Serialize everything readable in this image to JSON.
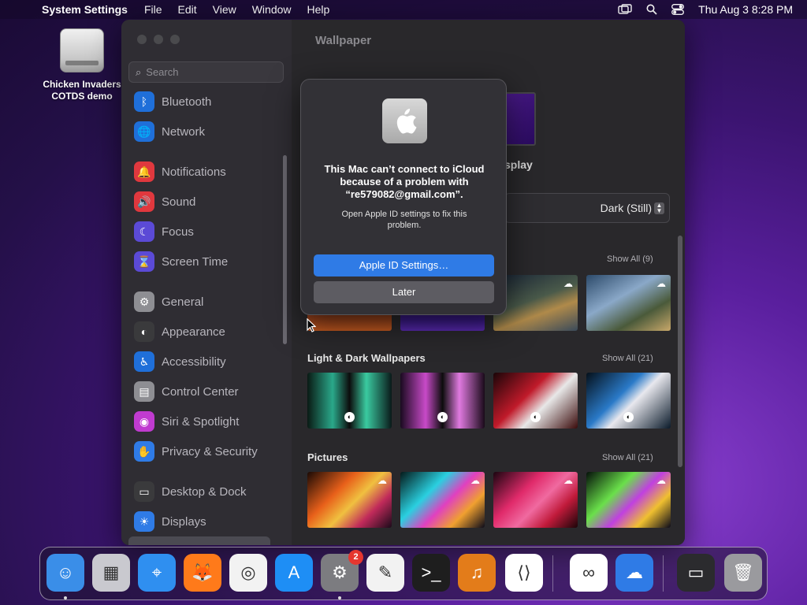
{
  "menubar": {
    "app_name": "System Settings",
    "menus": [
      "File",
      "Edit",
      "View",
      "Window",
      "Help"
    ],
    "clock": "Thu Aug 3  8:28 PM"
  },
  "desktop": {
    "icon_label_line1": "Chicken Invaders",
    "icon_label_line2": "COTDS demo"
  },
  "sidebar": {
    "search_placeholder": "Search",
    "items": [
      {
        "label": "Bluetooth",
        "color": "#1f6fd9",
        "glyph": "ᛒ"
      },
      {
        "label": "Network",
        "color": "#1f6fd9",
        "glyph": "🌐"
      },
      {
        "label": "Notifications",
        "color": "#e0383e",
        "glyph": "🔔"
      },
      {
        "label": "Sound",
        "color": "#e0383e",
        "glyph": "🔊"
      },
      {
        "label": "Focus",
        "color": "#5b4ad6",
        "glyph": "☾"
      },
      {
        "label": "Screen Time",
        "color": "#5b4ad6",
        "glyph": "⌛"
      },
      {
        "label": "General",
        "color": "#8e8e93",
        "glyph": "⚙"
      },
      {
        "label": "Appearance",
        "color": "#3a3a3c",
        "glyph": "◐"
      },
      {
        "label": "Accessibility",
        "color": "#1f6fd9",
        "glyph": "♿"
      },
      {
        "label": "Control Center",
        "color": "#8e8e93",
        "glyph": "▤"
      },
      {
        "label": "Siri & Spotlight",
        "color": "#c03bd0",
        "glyph": "◉"
      },
      {
        "label": "Privacy & Security",
        "color": "#2f7be6",
        "glyph": "✋"
      },
      {
        "label": "Desktop & Dock",
        "color": "#3a3a3c",
        "glyph": "▭"
      },
      {
        "label": "Displays",
        "color": "#2f7be6",
        "glyph": "☀"
      }
    ]
  },
  "main": {
    "title": "Wallpaper",
    "display_label_fragment": "splay",
    "appearance_value": "Dark (Still)",
    "sections": [
      {
        "title": "",
        "show_all": "Show All (9)"
      },
      {
        "title": "Light & Dark Wallpapers",
        "show_all": "Show All (21)"
      },
      {
        "title": "Pictures",
        "show_all": "Show All (21)"
      }
    ]
  },
  "dialog": {
    "title": "This Mac can’t connect to iCloud because of a problem with “re579082@gmail.com”.",
    "body": "Open Apple ID settings to fix this problem.",
    "primary_button": "Apple ID Settings…",
    "secondary_button": "Later"
  },
  "dock": {
    "apps": [
      {
        "name": "Finder",
        "color": "#3a8ee8",
        "running": true
      },
      {
        "name": "Launchpad",
        "color": "#c9c9cf",
        "running": false
      },
      {
        "name": "Safari",
        "color": "#2f8ff0",
        "running": false
      },
      {
        "name": "Firefox",
        "color": "#ff7a1a",
        "running": false
      },
      {
        "name": "Chrome",
        "color": "#f2f2f2",
        "running": false
      },
      {
        "name": "App Store",
        "color": "#1e8ef5",
        "running": false
      },
      {
        "name": "System Settings",
        "color": "#7c7c80",
        "running": true,
        "badge": "2"
      },
      {
        "name": "TextEdit",
        "color": "#f2f2f2",
        "running": false
      },
      {
        "name": "Terminal",
        "color": "#1e1e1e",
        "running": false
      },
      {
        "name": "GarageBand",
        "color": "#e37c1a",
        "running": false
      },
      {
        "name": "Visual Studio Code",
        "color": "#ffffff",
        "running": false
      },
      {
        "name": "Visual Studio",
        "color": "#ffffff",
        "running": false
      },
      {
        "name": "Weather",
        "color": "#2f7be6",
        "running": false
      },
      {
        "name": "Chrome Window",
        "color": "#2b2b2e",
        "running": false
      },
      {
        "name": "Trash",
        "color": "#9a9a9e",
        "running": false
      }
    ]
  }
}
